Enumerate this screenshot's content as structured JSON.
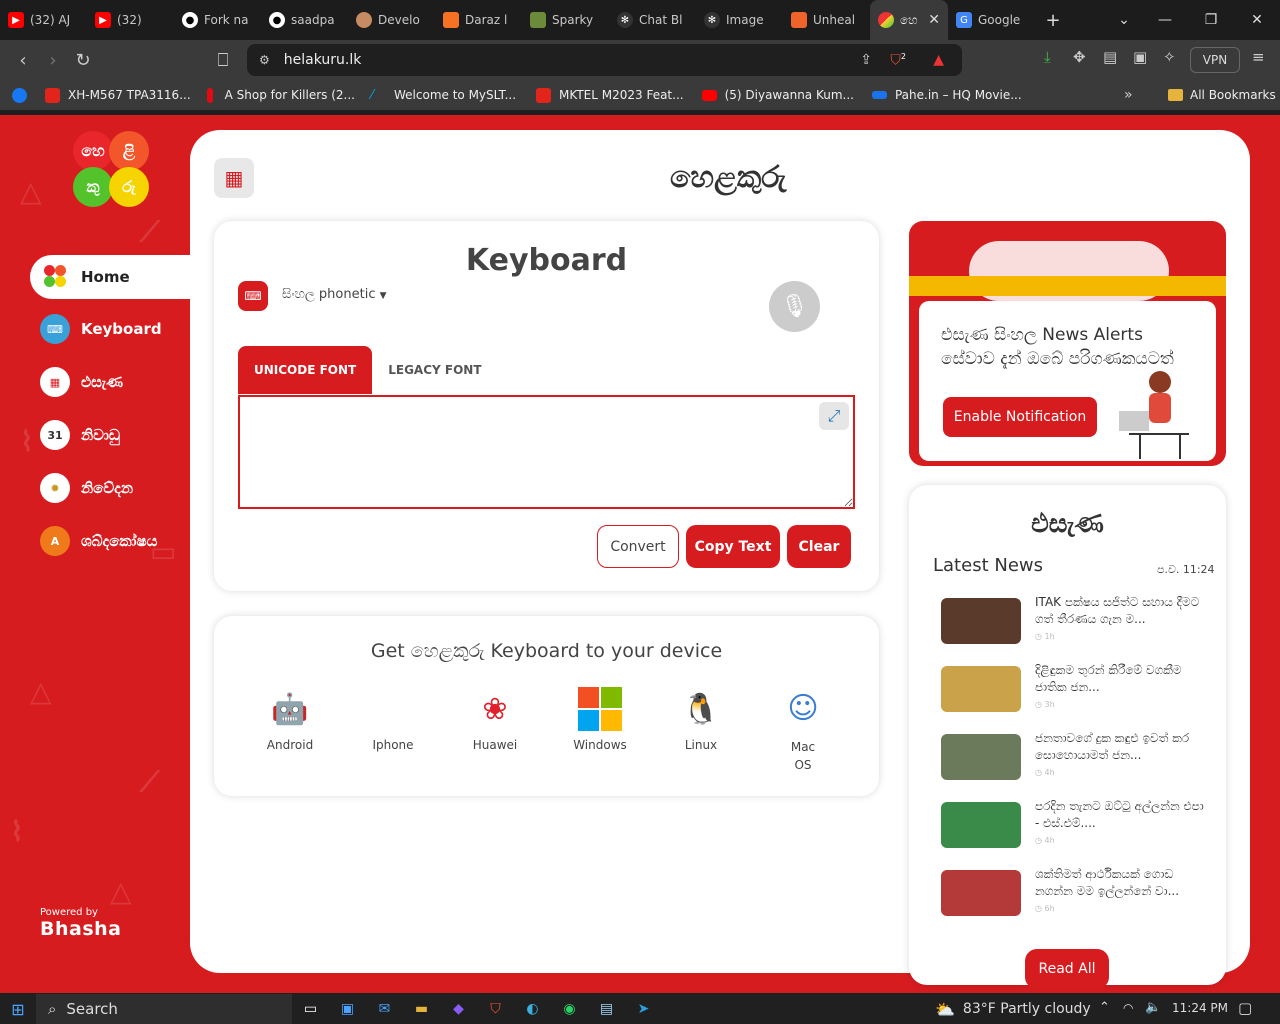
{
  "browser": {
    "tabs": [
      {
        "title": "(32) AJ",
        "icon": "youtube-icon"
      },
      {
        "title": "(32)",
        "icon": "youtube-icon"
      },
      {
        "title": "Fork na",
        "icon": "github-icon"
      },
      {
        "title": "saadpa",
        "icon": "github-icon"
      },
      {
        "title": "Develo",
        "icon": "avatar-icon"
      },
      {
        "title": "Daraz l",
        "icon": "daraz-icon"
      },
      {
        "title": "Sparky",
        "icon": "sparky-icon"
      },
      {
        "title": "Chat Bl",
        "icon": "openai-icon"
      },
      {
        "title": "Image",
        "icon": "openai-icon"
      },
      {
        "title": "Unheal",
        "icon": "unheal-icon"
      }
    ],
    "active_tab": {
      "title": "හෙ",
      "icon": "helakuru-icon"
    },
    "last_tab": {
      "title": "Google",
      "icon": "google-translate-icon"
    },
    "url": "helakuru.lk",
    "vpn_label": "VPN",
    "brave_badge": "2",
    "bookmarks": [
      {
        "label": "XH-M567 TPA3116...",
        "color": "#e1251b"
      },
      {
        "label": "A Shop for Killers (2...",
        "color": "#e50914"
      },
      {
        "label": "Welcome to MySLT...",
        "color": "#00a3e0"
      },
      {
        "label": "MKTEL M2023 Feat...",
        "color": "#e1251b"
      },
      {
        "label": "(5) Diyawanna Kum...",
        "color": "#ff0000"
      },
      {
        "label": "Pahe.in – HQ Movie...",
        "color": "#1a73e8"
      }
    ],
    "all_bookmarks": "All Bookmarks"
  },
  "site": {
    "brand": "හෙළකුරු",
    "logo_letters": [
      "හෙ",
      "ළි",
      "කු",
      "රු"
    ],
    "sidebar": [
      {
        "label": "Home",
        "icon": "helakuru-logo-icon"
      },
      {
        "label": "Keyboard",
        "icon": "keyboard-icon"
      },
      {
        "label": "එසැණ",
        "icon": "esana-icon"
      },
      {
        "label": "නිවාඩු",
        "icon": "calendar-icon"
      },
      {
        "label": "නිවේදන",
        "icon": "emblem-icon"
      },
      {
        "label": "ශබ්දකෝෂය",
        "icon": "dictionary-icon"
      }
    ],
    "calendar_day": "31",
    "powered_by": "Powered by",
    "powered_brand": "Bhasha",
    "keyboard": {
      "title": "Keyboard",
      "language": "සිංහල phonetic",
      "tabs": [
        "UNICODE FONT",
        "LEGACY FONT"
      ],
      "textarea_value": "",
      "buttons": {
        "convert": "Convert",
        "copy": "Copy Text",
        "clear": "Clear"
      }
    },
    "get": {
      "title": "Get හෙළකුරු Keyboard to your device",
      "platforms": [
        {
          "label": "Android",
          "icon": "android-icon"
        },
        {
          "label": "Iphone",
          "icon": "apple-icon"
        },
        {
          "label": "Huawei",
          "icon": "huawei-icon"
        },
        {
          "label": "Windows",
          "icon": "windows-icon"
        },
        {
          "label": "Linux",
          "icon": "linux-icon"
        },
        {
          "label": "Mac OS",
          "icon": "mac-icon"
        }
      ]
    },
    "alert": {
      "text": "එසැණ සිංහල News Alerts සේවාව දැන් ඔබේ පරිගණකයටත්",
      "button": "Enable Notification"
    },
    "news": {
      "title": "එසැණ",
      "subtitle": "Latest News",
      "time": "ප.ව. 11:24",
      "items": [
        {
          "text": "ITAK පක්ෂය සජිත්ට සහාය දීමට ගත් තීරණය ගැන ම...",
          "ago": "1h",
          "color": "#5a3a2a"
        },
        {
          "text": "දිළිඳුකම තුරන් කිරීමේ වගකීම ජාතික ජන...",
          "ago": "3h",
          "color": "#c9a24a"
        },
        {
          "text": "ජනතාවගේ දුක කඳුළු ඉවත් කර සොහොයාමත් ජන...",
          "ago": "4h",
          "color": "#6a7a5a"
        },
        {
          "text": "පරදින තැනට ඔට්ටු අල්ලන්න එපා - එස්.එම්....",
          "ago": "4h",
          "color": "#3a8a4a"
        },
        {
          "text": "ශක්තිමත් ආර්ථිකයක් ගොඩ නගන්න මම ඉල්ලන්නේ වා...",
          "ago": "6h",
          "color": "#b43a3a"
        }
      ],
      "read_all": "Read All"
    }
  },
  "taskbar": {
    "search": "Search",
    "weather_temp": "83°F",
    "weather_desc": "Partly cloudy",
    "time": "11:24 PM"
  },
  "colors": {
    "brand_red": "#d71c20",
    "white": "#ffffff"
  }
}
